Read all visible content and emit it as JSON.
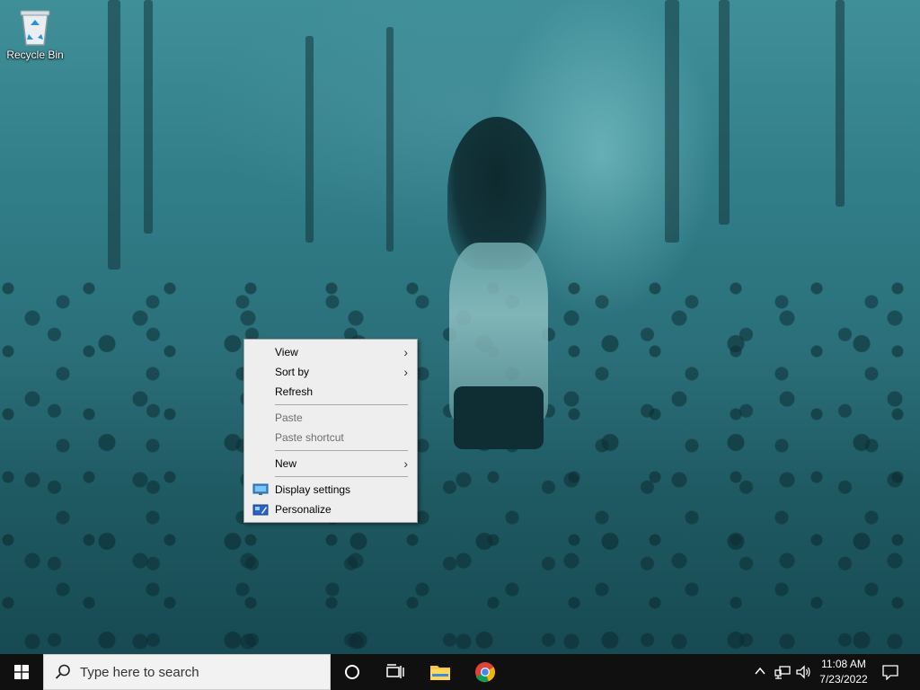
{
  "desktop": {
    "icons": [
      {
        "label": "Recycle Bin",
        "icon": "recycle-bin-icon"
      }
    ]
  },
  "context_menu": {
    "items": [
      {
        "label": "View",
        "submenu": true,
        "enabled": true
      },
      {
        "label": "Sort by",
        "submenu": true,
        "enabled": true
      },
      {
        "label": "Refresh",
        "submenu": false,
        "enabled": true
      },
      {
        "label": "Paste",
        "submenu": false,
        "enabled": false
      },
      {
        "label": "Paste shortcut",
        "submenu": false,
        "enabled": false
      },
      {
        "label": "New",
        "submenu": true,
        "enabled": true
      },
      {
        "label": "Display settings",
        "submenu": false,
        "enabled": true,
        "icon": "display-icon"
      },
      {
        "label": "Personalize",
        "submenu": false,
        "enabled": true,
        "icon": "personalize-icon"
      }
    ],
    "submenu_arrow": "›"
  },
  "taskbar": {
    "search": {
      "placeholder": "Type here to search"
    },
    "pinned": [
      {
        "name": "cortana",
        "icon": "cortana-icon"
      },
      {
        "name": "task-view",
        "icon": "task-view-icon"
      },
      {
        "name": "file-explorer",
        "icon": "folder-icon"
      },
      {
        "name": "chrome",
        "icon": "chrome-icon"
      }
    ],
    "clock": {
      "time": "11:08 AM",
      "date": "7/23/2022"
    }
  },
  "colors": {
    "taskbar": "#101010",
    "menu_bg": "#eeeeee",
    "windows_blue": "#0078d7"
  }
}
